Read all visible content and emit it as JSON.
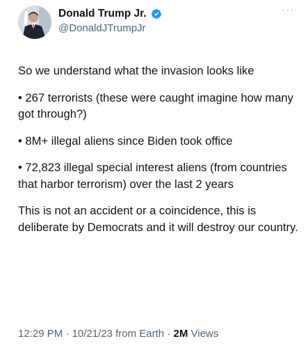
{
  "author": {
    "display_name": "Donald Trump Jr.",
    "handle": "@DonaldJTrumpJr"
  },
  "icons": {
    "verified": "verified-badge-icon",
    "more": "more-options-icon"
  },
  "colors": {
    "verified_blue": "#1d9bf0",
    "text": "#0f1419",
    "secondary": "#536471"
  },
  "tweet": {
    "intro": "So we understand what the invasion looks like",
    "bullets": [
      "• 267 terrorists (these were caught imagine how many got through?)",
      "• 8M+ illegal aliens since Biden took office",
      "• 72,823 illegal special interest aliens (from countries that harbor terrorism) over the last 2 years"
    ],
    "closing": "This is not an accident or a coincidence, this is deliberate by Democrats and it will destroy our country."
  },
  "meta": {
    "time": "12:29 PM",
    "separator": "·",
    "date": "10/21/23",
    "source": "from Earth",
    "views_count": "2M",
    "views_label": "Views"
  }
}
